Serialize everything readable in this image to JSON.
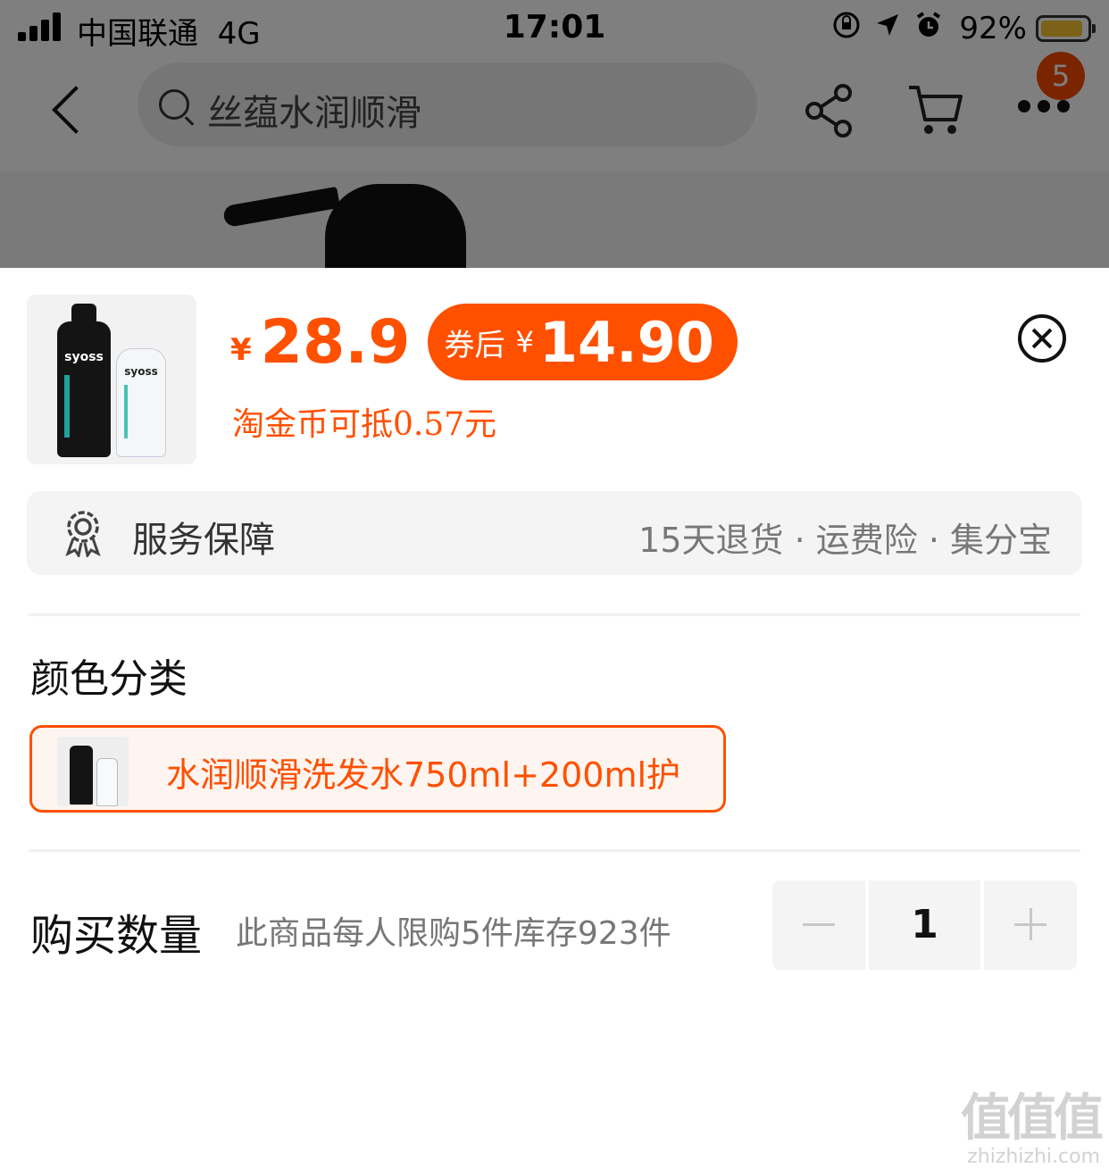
{
  "status_bar": {
    "carrier": "中国联通",
    "network": "4G",
    "time": "17:01",
    "battery_percent": "92%",
    "battery_level": 0.92,
    "icons": [
      "rotation-lock-icon",
      "location-arrow-icon",
      "alarm-icon"
    ]
  },
  "nav": {
    "search_placeholder": "丝蕴水润顺滑",
    "badge_count": "5",
    "icons": [
      "back-icon",
      "search-icon",
      "share-icon",
      "cart-icon",
      "more-icon"
    ]
  },
  "product": {
    "thumb_brand": "syoss",
    "currency_symbol": "¥",
    "price": "28.9",
    "coupon_label": "券后",
    "coupon_currency": "¥",
    "coupon_price": "14.90",
    "coin_offset": "淘金币可抵0.57元"
  },
  "service": {
    "title": "服务保障",
    "detail": "15天退货 · 运费险 · 集分宝"
  },
  "variant": {
    "section_title": "颜色分类",
    "options": [
      {
        "label": "水润顺滑洗发水750ml+200ml护",
        "selected": true
      }
    ]
  },
  "quantity": {
    "title": "购买数量",
    "note": "此商品每人限购5件库存923件",
    "value": "1"
  },
  "watermark": {
    "logo": "值值值",
    "url": "zhizhizhi.com"
  },
  "colors": {
    "accent": "#ff5000",
    "text_primary": "#111111",
    "text_secondary": "#777777",
    "panel_bg": "#f4f4f4"
  }
}
